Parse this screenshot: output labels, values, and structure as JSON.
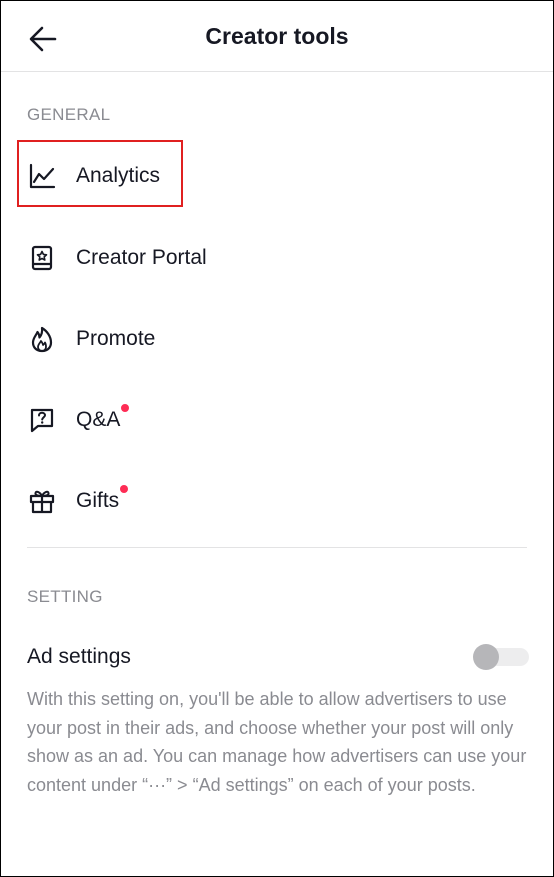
{
  "header": {
    "title": "Creator tools",
    "back_icon": "arrow-left-icon"
  },
  "general": {
    "label": "GENERAL",
    "items": [
      {
        "label": "Analytics",
        "icon": "line-chart-icon",
        "dot": false,
        "highlighted": true
      },
      {
        "label": "Creator Portal",
        "icon": "creator-portal-icon",
        "dot": false
      },
      {
        "label": "Promote",
        "icon": "flame-icon",
        "dot": false
      },
      {
        "label": "Q&A",
        "icon": "question-bubble-icon",
        "dot": true
      },
      {
        "label": "Gifts",
        "icon": "gift-icon",
        "dot": true
      }
    ]
  },
  "setting": {
    "label": "SETTING",
    "ad_settings": {
      "title": "Ad settings",
      "enabled": false,
      "description": "With this setting on, you'll be able to allow advertisers to use your post in their ads, and choose whether your post will only show as an ad. You can manage how advertisers can use your content under “···” > “Ad settings” on each of your posts."
    }
  },
  "colors": {
    "notification_dot": "#fe2c55",
    "highlight_box": "#e02020",
    "secondary_text": "#8a8b91",
    "primary_text": "#161823"
  }
}
